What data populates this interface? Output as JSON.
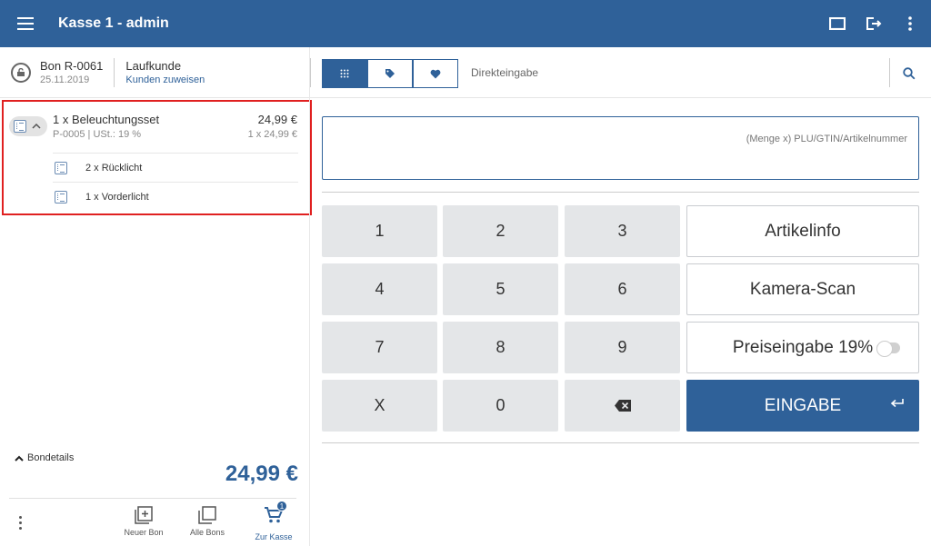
{
  "header": {
    "title": "Kasse 1 - admin"
  },
  "bon": {
    "id": "Bon R-0061",
    "date": "25.11.2019",
    "customer": "Laufkunde",
    "assign_link": "Kunden zuweisen"
  },
  "item": {
    "name": "1 x Beleuchtungsset",
    "sub": "P-0005 | USt.: 19 %",
    "price": "24,99 €",
    "unit_price": "1 x 24,99 €",
    "components": [
      {
        "label": "2 x  Rücklicht"
      },
      {
        "label": "1 x  Vorderlicht"
      }
    ]
  },
  "summary": {
    "details_label": "Bondetails",
    "total": "24,99 €"
  },
  "bottom_nav": {
    "new_bon": "Neuer Bon",
    "all_bons": "Alle Bons",
    "checkout": "Zur Kasse",
    "cart_count": "1"
  },
  "entry": {
    "direct_label": "Direkteingabe",
    "placeholder": "(Menge x) PLU/GTIN/Artikelnummer"
  },
  "keypad": {
    "keys": [
      "1",
      "2",
      "3",
      "4",
      "5",
      "6",
      "7",
      "8",
      "9",
      "X",
      "0"
    ],
    "article_info": "Artikelinfo",
    "camera_scan": "Kamera-Scan",
    "price_entry": "Preiseingabe 19%",
    "enter": "EINGABE"
  },
  "colors": {
    "primary": "#2f6199",
    "highlight_border": "#e02020",
    "key_bg": "#e4e6e8"
  }
}
